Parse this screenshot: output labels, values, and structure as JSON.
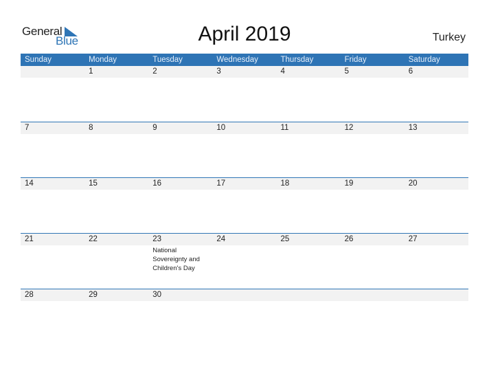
{
  "logo": {
    "text_top": "General",
    "text_bottom": "Blue"
  },
  "title": "April 2019",
  "country": "Turkey",
  "accent_color": "#2e74b5",
  "weekdays": [
    "Sunday",
    "Monday",
    "Tuesday",
    "Wednesday",
    "Thursday",
    "Friday",
    "Saturday"
  ],
  "weeks": [
    {
      "days": [
        {
          "num": ""
        },
        {
          "num": "1"
        },
        {
          "num": "2"
        },
        {
          "num": "3"
        },
        {
          "num": "4"
        },
        {
          "num": "5"
        },
        {
          "num": "6"
        }
      ]
    },
    {
      "days": [
        {
          "num": "7"
        },
        {
          "num": "8"
        },
        {
          "num": "9"
        },
        {
          "num": "10"
        },
        {
          "num": "11"
        },
        {
          "num": "12"
        },
        {
          "num": "13"
        }
      ]
    },
    {
      "days": [
        {
          "num": "14"
        },
        {
          "num": "15"
        },
        {
          "num": "16"
        },
        {
          "num": "17"
        },
        {
          "num": "18"
        },
        {
          "num": "19"
        },
        {
          "num": "20"
        }
      ]
    },
    {
      "days": [
        {
          "num": "21"
        },
        {
          "num": "22"
        },
        {
          "num": "23",
          "event": "National Sovereignty and Children's Day"
        },
        {
          "num": "24"
        },
        {
          "num": "25"
        },
        {
          "num": "26"
        },
        {
          "num": "27"
        }
      ]
    },
    {
      "days": [
        {
          "num": "28"
        },
        {
          "num": "29"
        },
        {
          "num": "30"
        },
        {
          "num": ""
        },
        {
          "num": ""
        },
        {
          "num": ""
        },
        {
          "num": ""
        }
      ]
    }
  ]
}
